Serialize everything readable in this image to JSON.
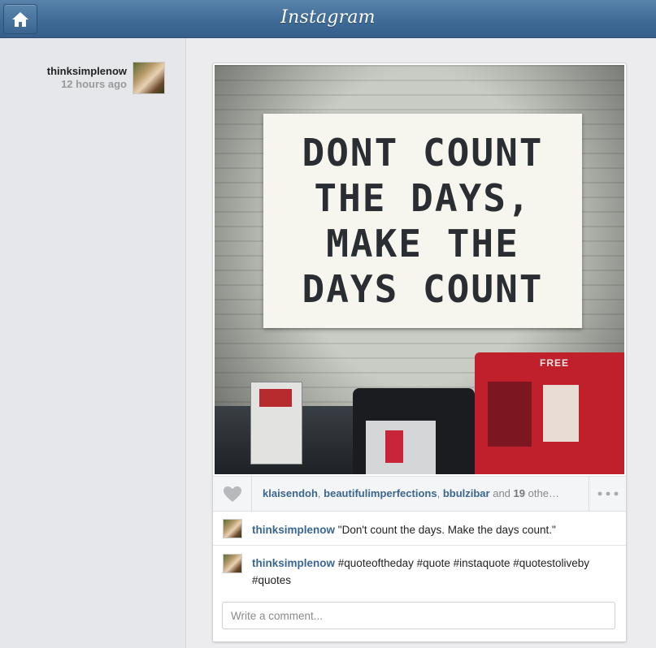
{
  "app": {
    "title": "Instagram"
  },
  "topbar": {
    "home_icon": "home-icon"
  },
  "post": {
    "username": "thinksimplenow",
    "time_ago": "12 hours ago",
    "photo_text": [
      "DONT COUNT",
      "THE DAYS,",
      "MAKE THE",
      "DAYS COUNT"
    ],
    "photo_sign_free": "FREE",
    "likes": {
      "users": [
        "klaisendoh",
        "beautifulimperfections",
        "bbulzibar"
      ],
      "separator": ", ",
      "and_text": "and",
      "others_count": "19",
      "others_text": "othe…"
    },
    "comments": [
      {
        "user": "thinksimplenow",
        "text": "\"Don't count the days. Make the days count.\""
      },
      {
        "user": "thinksimplenow",
        "text": "#quoteoftheday #quote #instaquote #quotestoliveby #quotes"
      }
    ],
    "comment_placeholder": "Write a comment..."
  },
  "colors": {
    "topbar": "#3f6b96",
    "link": "#3b6690",
    "muted": "#9a9a9a"
  }
}
